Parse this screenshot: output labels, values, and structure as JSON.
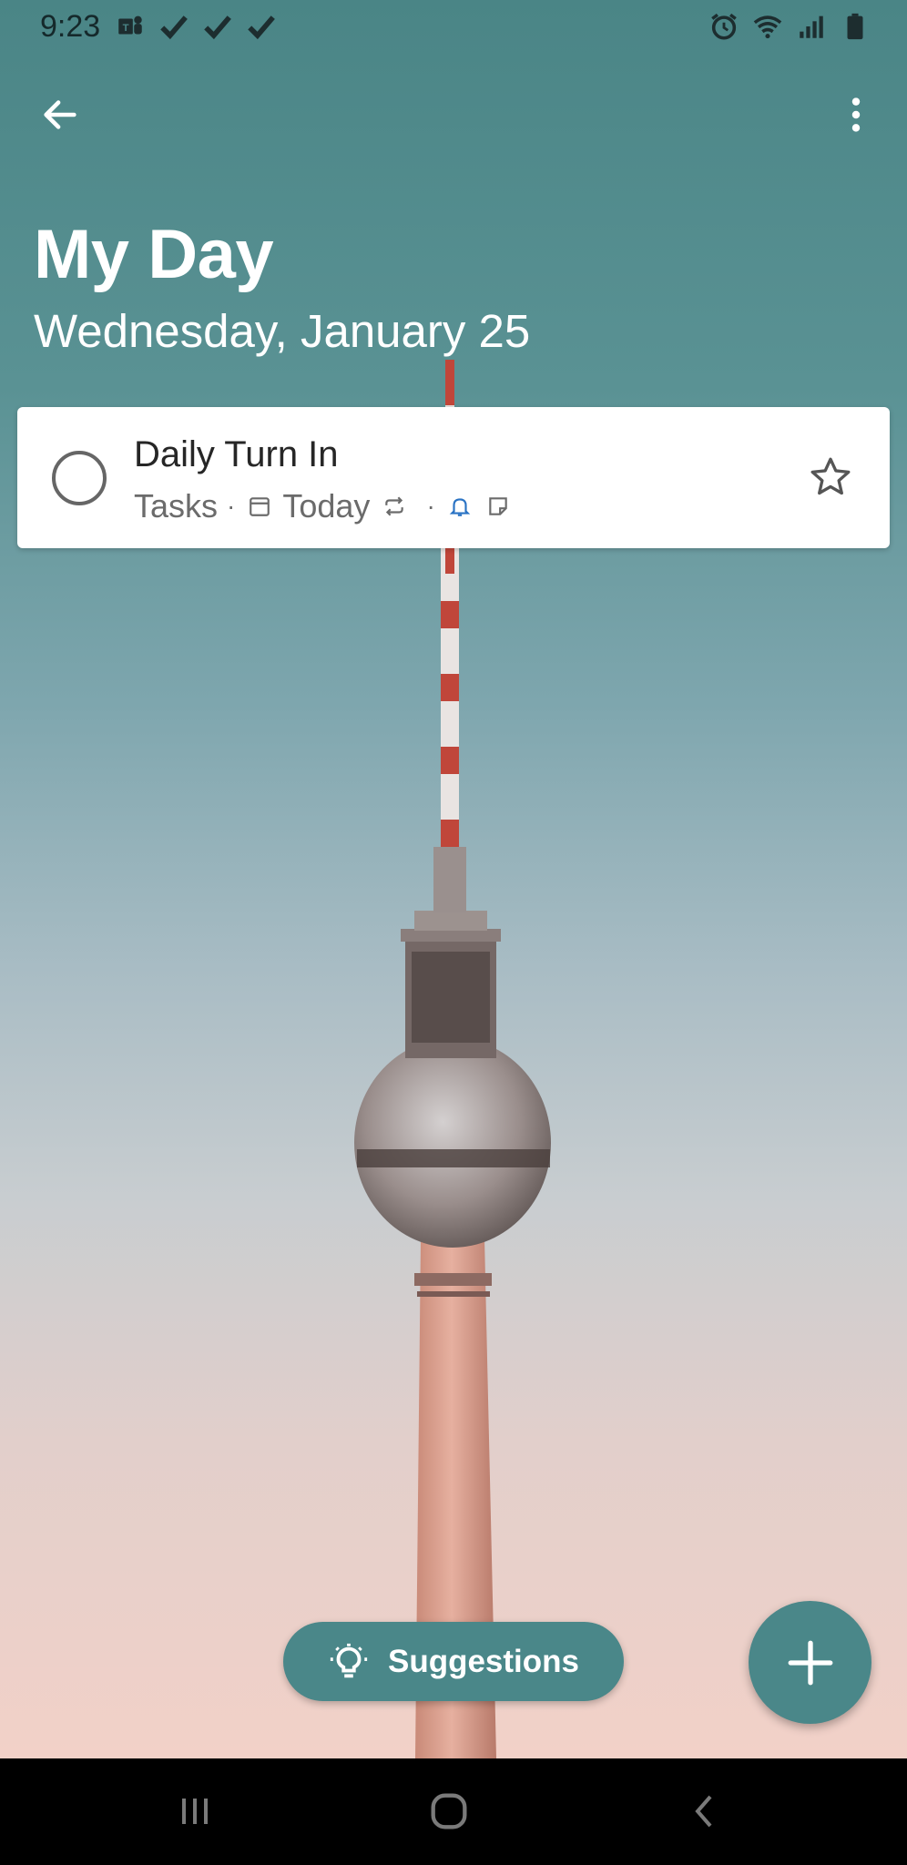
{
  "status_bar": {
    "time": "9:23",
    "left_icons": [
      "teams-icon",
      "check-icon",
      "check-icon",
      "check-icon"
    ],
    "right_icons": [
      "alarm-icon",
      "wifi-icon",
      "signal-icon",
      "battery-icon"
    ]
  },
  "app_bar": {
    "back_icon": "arrow-left-icon",
    "menu_icon": "more-vert-icon"
  },
  "header": {
    "title": "My Day",
    "date": "Wednesday, January 25"
  },
  "tasks": [
    {
      "title": "Daily Turn In",
      "list": "Tasks",
      "due": "Today",
      "completed": false,
      "starred": false,
      "icons": [
        "calendar-icon",
        "repeat-icon",
        "reminder-bell-icon",
        "note-icon"
      ]
    }
  ],
  "suggestions_button": {
    "label": "Suggestions",
    "icon": "lightbulb-icon"
  },
  "fab": {
    "icon": "plus-icon"
  },
  "colors": {
    "accent": "#4a8789",
    "reminder_icon": "#2a73c4",
    "card_bg": "#ffffff"
  },
  "nav_bar": {
    "buttons": [
      "recents-icon",
      "home-icon",
      "back-icon"
    ]
  }
}
